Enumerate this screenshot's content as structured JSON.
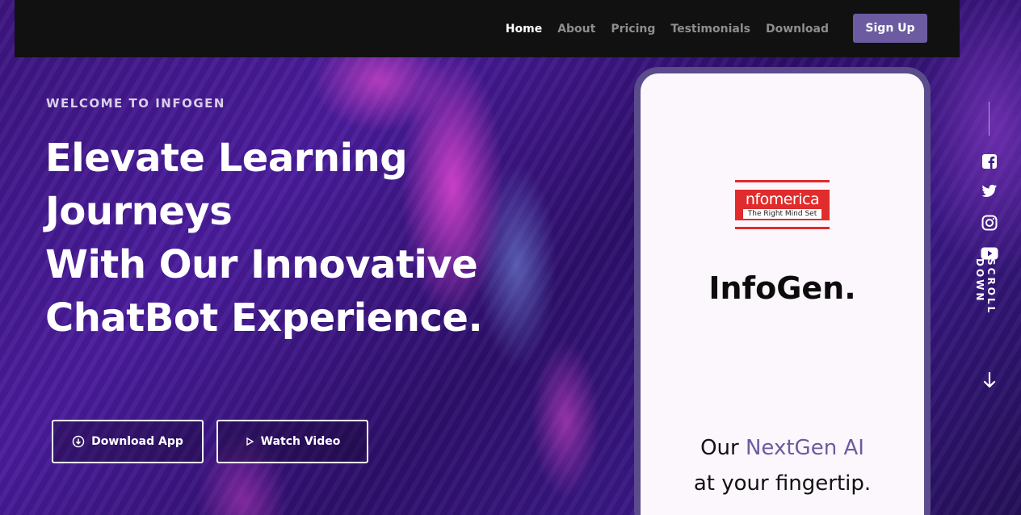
{
  "nav": {
    "items": [
      {
        "label": "Home",
        "active": true
      },
      {
        "label": "About",
        "active": false
      },
      {
        "label": "Pricing",
        "active": false
      },
      {
        "label": "Testimonials",
        "active": false
      },
      {
        "label": "Download",
        "active": false
      }
    ],
    "signup_label": "Sign Up"
  },
  "hero": {
    "kicker": "WELCOME TO INFOGEN",
    "headline_lines": [
      "Elevate Learning",
      "Journeys",
      "With Our Innovative",
      "ChatBot Experience."
    ],
    "download_label": "Download App",
    "watch_label": "Watch Video"
  },
  "phone": {
    "logo_word": "nfomerica",
    "logo_tagline": "The Right Mind Set",
    "brand_name": "InfoGen.",
    "tagline_prefix": "Our ",
    "tagline_accent": "NextGen AI",
    "tagline_line2": "at your fingertip."
  },
  "sidebar": {
    "social_icons": [
      "facebook-icon",
      "twitter-icon",
      "instagram-icon",
      "youtube-icon"
    ],
    "scroll_label": "SCROLL DOWN"
  },
  "colors": {
    "accent": "#6c5ba0",
    "navbar": "#111111",
    "logo_red": "#e02c2c"
  }
}
